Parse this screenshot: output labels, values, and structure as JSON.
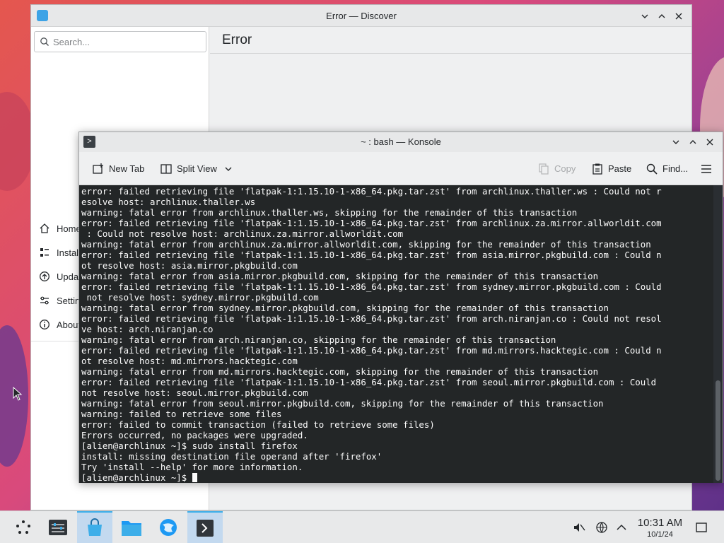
{
  "desktop": {
    "colors": {
      "wall_red": "#e4574e",
      "wall_purple": "#5a2f86"
    }
  },
  "discover": {
    "title": "Error — Discover",
    "search_placeholder": "Search...",
    "page_title": "Error",
    "nav": [
      {
        "label": "Home",
        "icon": "home-icon"
      },
      {
        "label": "Installed",
        "icon": "installed-icon"
      },
      {
        "label": "Updates",
        "icon": "updates-icon"
      },
      {
        "label": "Settings",
        "icon": "settings-icon"
      },
      {
        "label": "About",
        "icon": "about-icon"
      }
    ]
  },
  "konsole": {
    "title": "~ : bash — Konsole",
    "toolbar": {
      "new_tab": "New Tab",
      "split_view": "Split View",
      "copy": "Copy",
      "paste": "Paste",
      "find": "Find..."
    },
    "lines": [
      "error: failed retrieving file 'flatpak-1:1.15.10-1-x86_64.pkg.tar.zst' from archlinux.thaller.ws : Could not r",
      "esolve host: archlinux.thaller.ws",
      "warning: fatal error from archlinux.thaller.ws, skipping for the remainder of this transaction",
      "error: failed retrieving file 'flatpak-1:1.15.10-1-x86_64.pkg.tar.zst' from archlinux.za.mirror.allworldit.com",
      " : Could not resolve host: archlinux.za.mirror.allworldit.com",
      "warning: fatal error from archlinux.za.mirror.allworldit.com, skipping for the remainder of this transaction",
      "error: failed retrieving file 'flatpak-1:1.15.10-1-x86_64.pkg.tar.zst' from asia.mirror.pkgbuild.com : Could n",
      "ot resolve host: asia.mirror.pkgbuild.com",
      "warning: fatal error from asia.mirror.pkgbuild.com, skipping for the remainder of this transaction",
      "error: failed retrieving file 'flatpak-1:1.15.10-1-x86_64.pkg.tar.zst' from sydney.mirror.pkgbuild.com : Could",
      " not resolve host: sydney.mirror.pkgbuild.com",
      "warning: fatal error from sydney.mirror.pkgbuild.com, skipping for the remainder of this transaction",
      "error: failed retrieving file 'flatpak-1:1.15.10-1-x86_64.pkg.tar.zst' from arch.niranjan.co : Could not resol",
      "ve host: arch.niranjan.co",
      "warning: fatal error from arch.niranjan.co, skipping for the remainder of this transaction",
      "error: failed retrieving file 'flatpak-1:1.15.10-1-x86_64.pkg.tar.zst' from md.mirrors.hacktegic.com : Could n",
      "ot resolve host: md.mirrors.hacktegic.com",
      "warning: fatal error from md.mirrors.hacktegic.com, skipping for the remainder of this transaction",
      "error: failed retrieving file 'flatpak-1:1.15.10-1-x86_64.pkg.tar.zst' from seoul.mirror.pkgbuild.com : Could",
      "not resolve host: seoul.mirror.pkgbuild.com",
      "warning: fatal error from seoul.mirror.pkgbuild.com, skipping for the remainder of this transaction",
      "warning: failed to retrieve some files",
      "error: failed to commit transaction (failed to retrieve some files)",
      "Errors occurred, no packages were upgraded.",
      "[alien@archlinux ~]$ sudo install firefox",
      "install: missing destination file operand after 'firefox'",
      "Try 'install --help' for more information."
    ],
    "prompt": "[alien@archlinux ~]$ ",
    "colors": {
      "background": "#232627",
      "foreground": "#fcfcfc"
    }
  },
  "taskbar": {
    "clock_time": "10:31 AM",
    "clock_date": "10/1/24",
    "tasks": [
      {
        "name": "application-launcher",
        "icon": "launcher-icon"
      },
      {
        "name": "system-settings",
        "icon": "settings-app-icon"
      },
      {
        "name": "discover",
        "icon": "discover-icon",
        "active": true
      },
      {
        "name": "dolphin",
        "icon": "folder-icon"
      },
      {
        "name": "browser",
        "icon": "browser-icon"
      },
      {
        "name": "konsole",
        "icon": "terminal-icon",
        "active": true
      }
    ],
    "accent": "#3daee9"
  }
}
